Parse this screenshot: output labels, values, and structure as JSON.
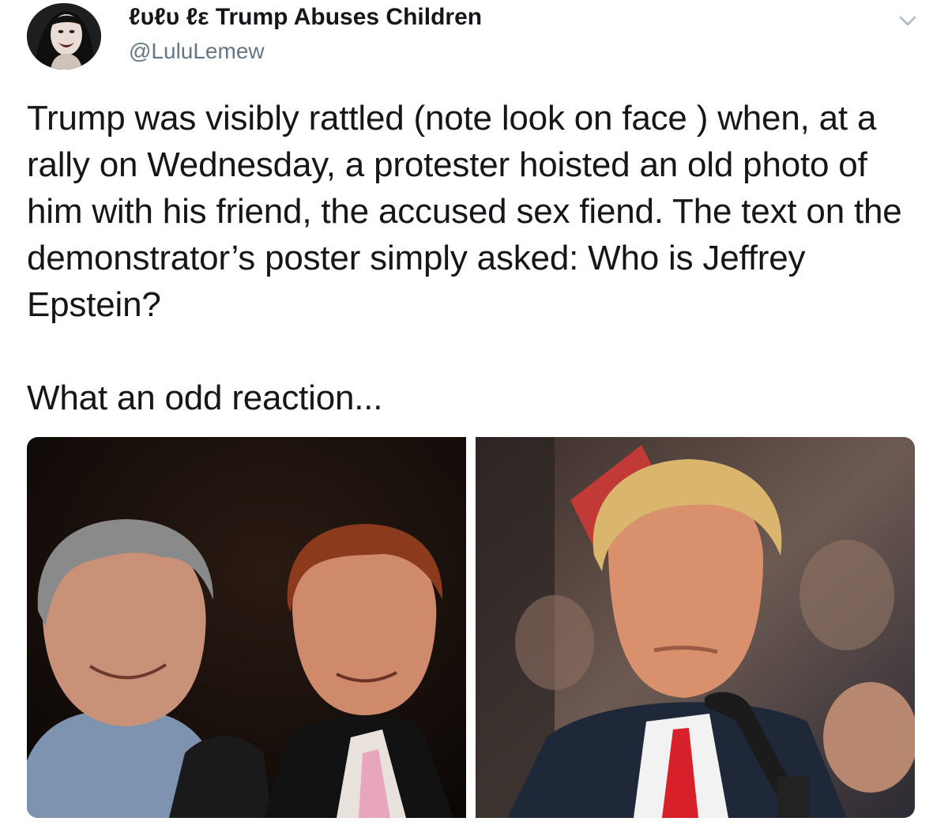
{
  "tweet": {
    "author": {
      "display_name": "ℓυℓυ ℓε Trump Abuses Children",
      "handle": "@LuluLemew"
    },
    "menu_icon": "chevron-down-icon",
    "text": "Trump was visibly rattled (note look on face ) when, at a rally on Wednesday, a protester hoisted an old photo of him with his friend, the accused sex fiend. The text on the demonstrator’s poster simply asked: Who is Jeffrey Epstein?\n\nWhat an odd reaction...",
    "media": [
      {
        "kind": "photo"
      },
      {
        "kind": "photo"
      }
    ]
  },
  "colors": {
    "text": "#14171a",
    "secondary_text": "#657786",
    "chevron": "#aab8c2",
    "background": "#ffffff"
  }
}
